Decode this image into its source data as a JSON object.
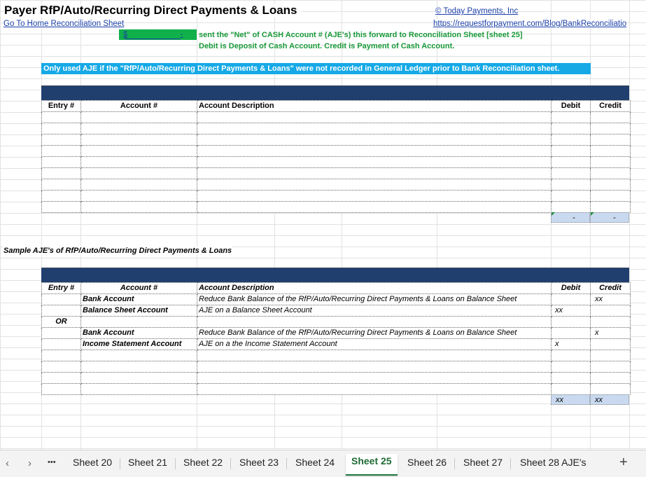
{
  "sheet": {
    "title": "Payer RfP/Auto/Recurring Direct Payments & Loans",
    "home_link": "Go To Home Reconciliation Sheet",
    "company_link": "© Today Payments, Inc",
    "url_link": "https://requestforpayment.com/Blog/BankReconciliatio",
    "net_value_symbol": "$",
    "net_value_dash": "-",
    "note_line1": "sent the \"Net\" of CASH Account # (AJE's) this forward to Reconciliation Sheet [sheet 25]",
    "note_line2": "Debit is Deposit of Cash Account.  Credit is Payment of Cash Account.",
    "banner": "Only used AJE if the \"RfP/Auto/Recurring Direct Payments & Loans\" were not recorded in General Ledger prior to Bank Reconciliation sheet."
  },
  "table1": {
    "headers": [
      "Entry #",
      "Account #",
      "Account Description",
      "Debit",
      "Credit"
    ],
    "total_debit": "-",
    "total_credit": "-"
  },
  "sample": {
    "heading": "Sample AJE's of RfP/Auto/Recurring Direct Payments & Loans",
    "headers": [
      "Entry #",
      "Account #",
      "Account Description",
      "Debit",
      "Credit"
    ],
    "rows": [
      {
        "entry": "",
        "account": "Bank Account",
        "desc": "Reduce Bank Balance of the RfP/Auto/Recurring Direct Payments & Loans on Balance Sheet",
        "debit": "",
        "credit": "xx"
      },
      {
        "entry": "",
        "account": "Balance Sheet Account",
        "desc": "AJE on a Balance Sheet Account",
        "debit": "xx",
        "credit": ""
      },
      {
        "entry": "OR",
        "account": "",
        "desc": "",
        "debit": "",
        "credit": ""
      },
      {
        "entry": "",
        "account": "Bank Account",
        "desc": "Reduce Bank Balance of the RfP/Auto/Recurring Direct Payments & Loans on Balance Sheet",
        "debit": "",
        "credit": "x"
      },
      {
        "entry": "",
        "account": "Income Statement Account",
        "desc": "AJE on a the Income Statement Account",
        "debit": "x",
        "credit": ""
      }
    ],
    "total_debit": "xx",
    "total_credit": "xx"
  },
  "tabs": {
    "items": [
      "Sheet 20",
      "Sheet 21",
      "Sheet 22",
      "Sheet 23",
      "Sheet 24",
      "Sheet 25",
      "Sheet 26",
      "Sheet 27",
      "Sheet 28 AJE's"
    ],
    "active": "Sheet 25",
    "more": "•••",
    "prev": "‹",
    "next": "›",
    "add": "+"
  },
  "colors": {
    "banner": "#16a9e6",
    "header_bar": "#203f6e",
    "total_fill": "#c9daf0",
    "green_text": "#1a9a3a",
    "active_tab": "#1e7a3e"
  }
}
